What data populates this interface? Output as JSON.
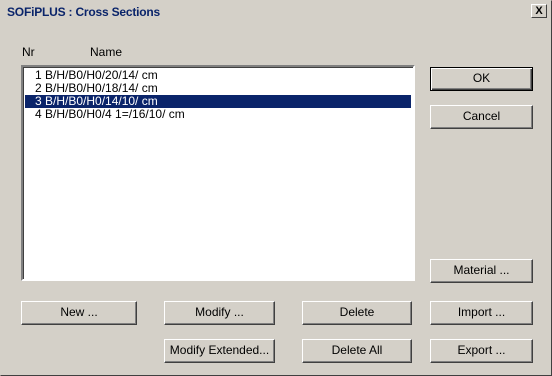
{
  "window": {
    "title": "SOFiPLUS : Cross Sections",
    "close_label": "X"
  },
  "list": {
    "header_nr": "Nr",
    "header_name": "Name",
    "items": [
      "1 B/H/B0/H0/20/14/ cm",
      "2 B/H/B0/H0/18/14/ cm",
      "3 B/H/B0/H0/14/10/ cm",
      "4 B/H/B0/H0/4 1=/16/10/ cm"
    ],
    "selected_index": 2
  },
  "buttons": {
    "ok": "OK",
    "cancel": "Cancel",
    "material": "Material ...",
    "new": "New ...",
    "modify": "Modify ...",
    "delete": "Delete",
    "import": "Import ...",
    "modify_extended": "Modify Extended...",
    "delete_all": "Delete All",
    "export": "Export ..."
  },
  "colors": {
    "face": "#d4d0c8",
    "selection": "#0a246a",
    "title_text": "#0a246a"
  }
}
